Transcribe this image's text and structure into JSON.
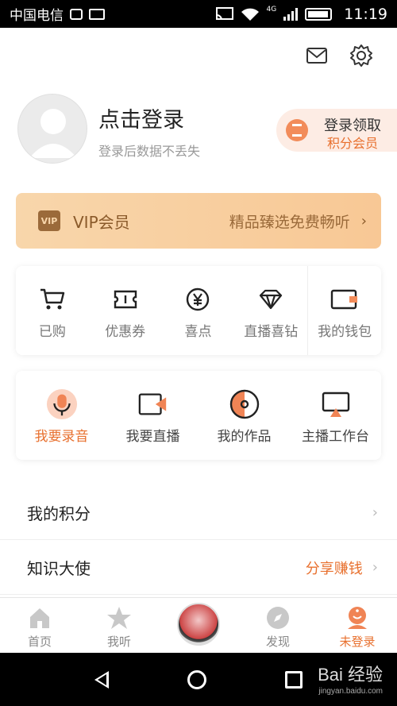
{
  "status_bar": {
    "carrier": "中国电信",
    "network": "4G",
    "time": "11:19"
  },
  "header": {
    "icons": [
      "mail-icon",
      "settings-icon"
    ]
  },
  "profile": {
    "login_title": "点击登录",
    "login_subtitle": "登录后数据不丢失",
    "promo_line1": "登录领取",
    "promo_line2": "积分会员"
  },
  "vip": {
    "badge": "VIP",
    "label": "VIP会员",
    "promo": "精品臻选免费畅听",
    "chevron": "›"
  },
  "quick_actions": [
    {
      "label": "已购",
      "icon": "cart-icon"
    },
    {
      "label": "优惠券",
      "icon": "coupon-icon"
    },
    {
      "label": "喜点",
      "icon": "yen-coin-icon"
    },
    {
      "label": "直播喜钻",
      "icon": "diamond-icon"
    },
    {
      "label": "我的钱包",
      "icon": "wallet-icon"
    }
  ],
  "creator_actions": [
    {
      "label": "我要录音",
      "icon": "microphone-icon",
      "active": true
    },
    {
      "label": "我要直播",
      "icon": "video-camera-icon",
      "active": false
    },
    {
      "label": "我的作品",
      "icon": "disc-icon",
      "active": false
    },
    {
      "label": "主播工作台",
      "icon": "monitor-icon",
      "active": false
    }
  ],
  "list": [
    {
      "name": "我的积分",
      "extra": "",
      "chevron": "›"
    },
    {
      "name": "知识大使",
      "extra": "分享赚钱",
      "chevron": "›"
    }
  ],
  "tabbar": [
    {
      "label": "首页",
      "icon": "home-icon",
      "active": false
    },
    {
      "label": "我听",
      "icon": "star-icon",
      "active": false
    },
    {
      "label": "",
      "icon": "player-disc-icon",
      "active": false
    },
    {
      "label": "发现",
      "icon": "compass-icon",
      "active": false
    },
    {
      "label": "未登录",
      "icon": "user-icon",
      "active": true
    }
  ],
  "colors": {
    "accent": "#e8702e",
    "vip_bg": "#f8d6ab",
    "promo_bg": "#fdece4"
  },
  "watermark": {
    "brand": "Bai 经验",
    "url": "jingyan.baidu.com"
  }
}
